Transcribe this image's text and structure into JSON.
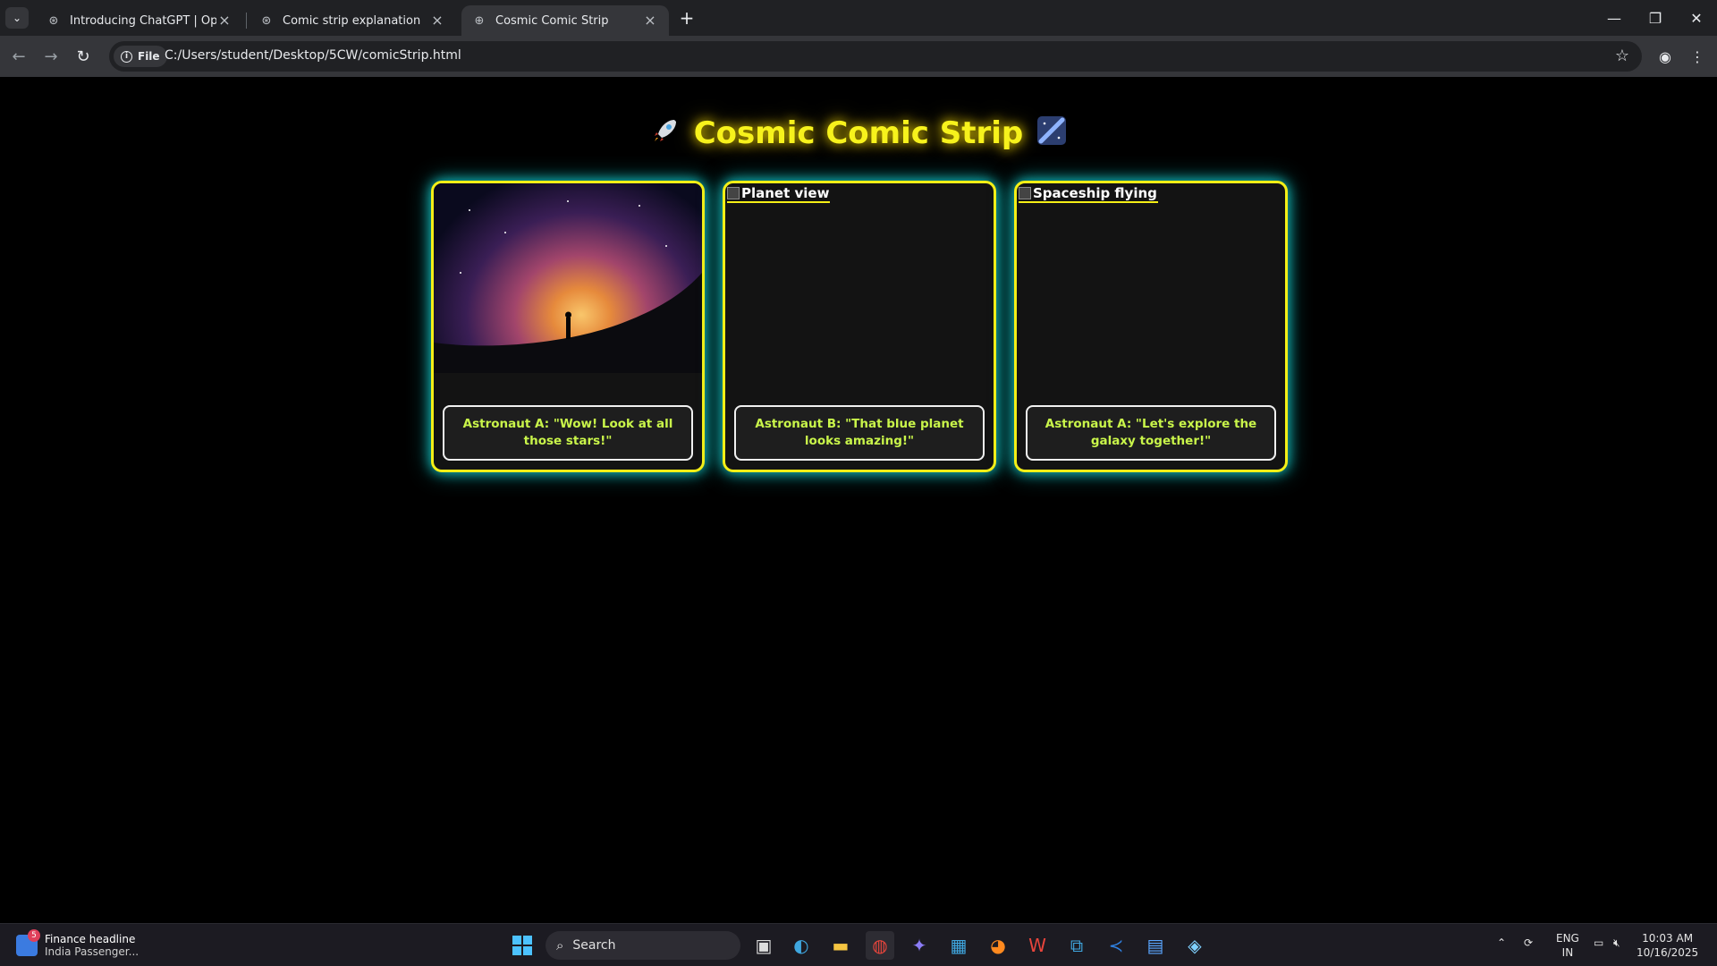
{
  "browser": {
    "tabs": [
      {
        "title": "Introducing ChatGPT | OpenAI",
        "active": false
      },
      {
        "title": "Comic strip explanation",
        "active": false
      },
      {
        "title": "Cosmic Comic Strip",
        "active": true
      }
    ],
    "address": {
      "chip": "File",
      "url": "C:/Users/student/Desktop/5CW/comicStrip.html"
    }
  },
  "page": {
    "heading": "Cosmic Comic Strip",
    "panels": [
      {
        "image_alt": "",
        "image_loaded": true,
        "caption": "Astronaut A: \"Wow! Look at all those stars!\""
      },
      {
        "image_alt": "Planet view",
        "image_loaded": false,
        "caption": "Astronaut B: \"That blue planet looks amazing!\""
      },
      {
        "image_alt": "Spaceship flying",
        "image_loaded": false,
        "caption": "Astronaut A: \"Let's explore the galaxy together!\""
      }
    ]
  },
  "taskbar": {
    "news": {
      "badge": "5",
      "headline": "Finance headline",
      "subline": "India Passenger..."
    },
    "search_placeholder": "Search",
    "lang": {
      "line1": "ENG",
      "line2": "IN"
    },
    "clock": {
      "time": "10:03 AM",
      "date": "10/16/2025"
    }
  },
  "colors": {
    "accent": "#f5ef16",
    "glow": "#13c6c6",
    "caption_text": "#c9f54a"
  }
}
